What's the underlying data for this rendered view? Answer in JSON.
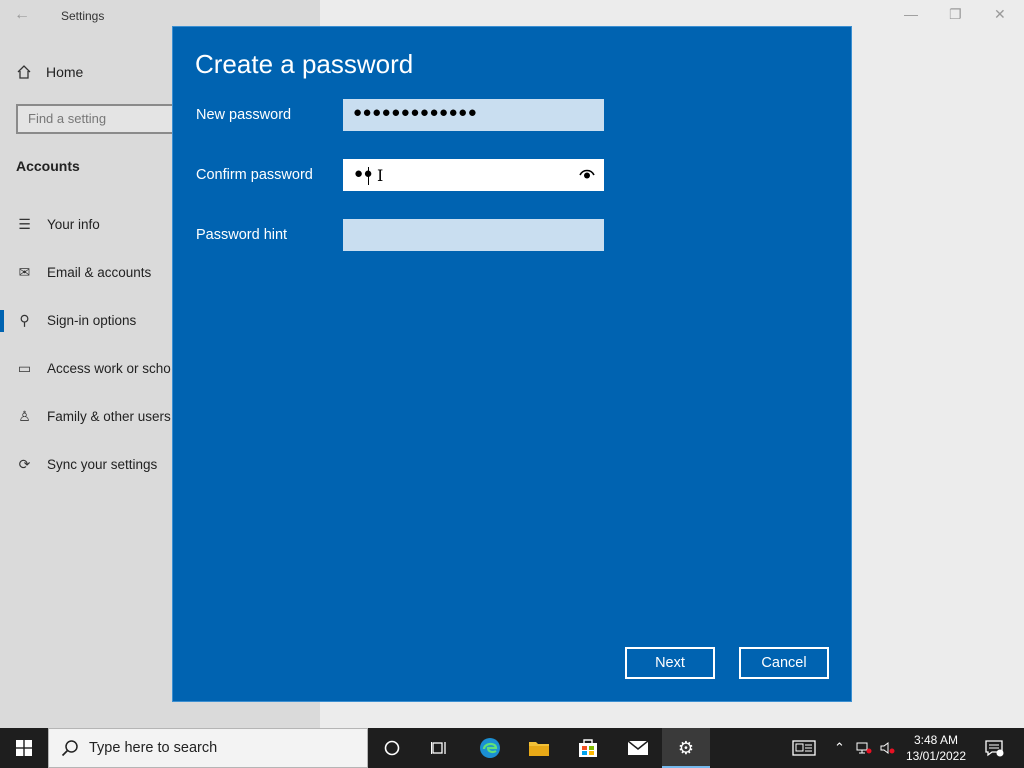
{
  "window": {
    "title": "Settings",
    "back_icon": "arrow-left-icon",
    "controls": [
      "minimize-icon",
      "maximize-icon",
      "close-icon"
    ]
  },
  "sidebar": {
    "home_label": "Home",
    "search_placeholder": "Find a setting",
    "section_title": "Accounts",
    "items": [
      {
        "label": "Your info",
        "icon": "person-card-icon"
      },
      {
        "label": "Email & accounts",
        "icon": "envelope-icon"
      },
      {
        "label": "Sign-in options",
        "icon": "key-icon",
        "active": true
      },
      {
        "label": "Access work or scho",
        "icon": "briefcase-icon"
      },
      {
        "label": "Family & other users",
        "icon": "person-add-icon"
      },
      {
        "label": "Sync your settings",
        "icon": "sync-icon"
      }
    ]
  },
  "dialog": {
    "title": "Create a password",
    "new_password": {
      "label": "New password",
      "value": "●●●●●●●●●●●●●"
    },
    "confirm_password": {
      "label": "Confirm password",
      "value": "●●"
    },
    "password_hint": {
      "label": "Password hint",
      "value": ""
    },
    "next_label": "Next",
    "cancel_label": "Cancel",
    "accent_color": "#0063b1"
  },
  "taskbar": {
    "search_placeholder": "Type here to search",
    "time": "3:48 AM",
    "date": "13/01/2022",
    "pinned": [
      "cortana-icon",
      "task-view-icon",
      "edge-icon",
      "file-explorer-icon",
      "store-icon",
      "mail-icon",
      "settings-icon"
    ]
  }
}
